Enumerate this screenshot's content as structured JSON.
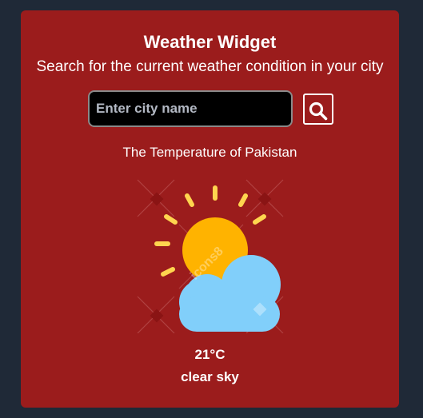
{
  "widget": {
    "title": "Weather Widget",
    "subtitle": "Search for the current weather condition in your city",
    "search": {
      "placeholder": "Enter city name",
      "value": "",
      "button_icon": "search-icon"
    },
    "caption": "The Temperature of Pakistan",
    "weather_icon": "partly-cloudy-day-icon",
    "watermark": "icons8",
    "temperature": "21°C",
    "condition": "clear sky"
  },
  "colors": {
    "page_background": "#1f2937",
    "card_background": "#9b1c1c",
    "sun": "#ffb300",
    "sun_rays": "#ffd54f",
    "cloud": "#81cffa"
  }
}
